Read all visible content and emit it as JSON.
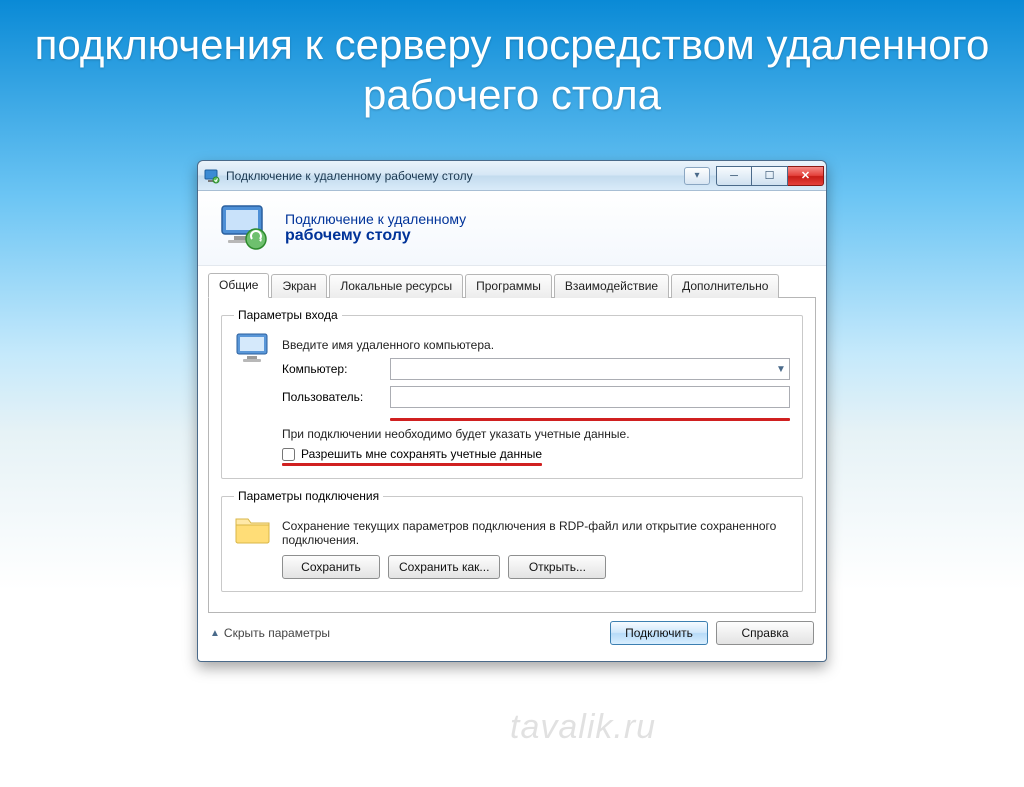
{
  "slide": {
    "title": "подключения к серверу посредством удаленного рабочего стола"
  },
  "window": {
    "title": "Подключение к удаленному рабочему столу",
    "hero_line1": "Подключение к удаленному",
    "hero_line2": "рабочему столу",
    "tabs": {
      "general": "Общие",
      "screen": "Экран",
      "local": "Локальные ресурсы",
      "programs": "Программы",
      "experience": "Взаимодействие",
      "advanced": "Дополнительно"
    },
    "login": {
      "legend": "Параметры входа",
      "instruction": "Введите имя удаленного компьютера.",
      "computer_label": "Компьютер:",
      "computer_value": "",
      "user_label": "Пользователь:",
      "user_value": "",
      "note": "При подключении необходимо будет указать учетные данные.",
      "remember_label": "Разрешить мне сохранять учетные данные"
    },
    "connection": {
      "legend": "Параметры подключения",
      "note": "Сохранение текущих параметров подключения в RDP-файл или открытие сохраненного подключения.",
      "save": "Сохранить",
      "save_as": "Сохранить как...",
      "open": "Открыть..."
    },
    "footer": {
      "hide": "Скрыть параметры",
      "connect": "Подключить",
      "help": "Справка"
    }
  },
  "watermark": "tavalik.ru"
}
